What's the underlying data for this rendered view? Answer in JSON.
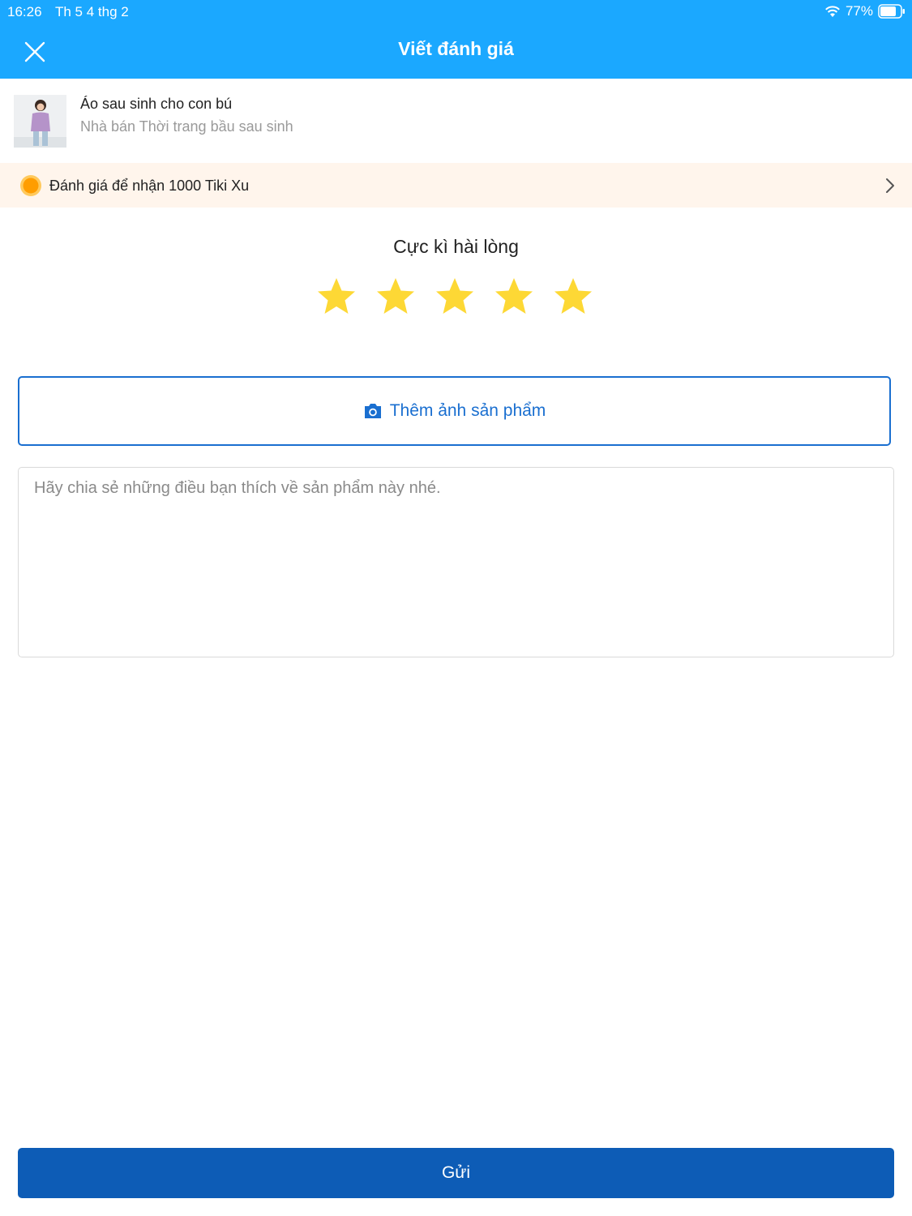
{
  "status_bar": {
    "time": "16:26",
    "date": "Th 5 4 thg 2",
    "battery": "77%"
  },
  "header": {
    "title": "Viết đánh giá"
  },
  "product": {
    "name": "Áo sau sinh cho con bú",
    "seller": "Nhà bán Thời trang bầu sau sinh"
  },
  "promo": {
    "text": "Đánh giá để nhận 1000 Tiki Xu"
  },
  "rating": {
    "label": "Cực kì hài lòng",
    "value": 5,
    "max": 5
  },
  "add_photo": {
    "label": "Thêm ảnh sản phẩm"
  },
  "review": {
    "placeholder": "Hãy chia sẻ những điều bạn thích về sản phẩm này nhé."
  },
  "submit": {
    "label": "Gửi"
  },
  "colors": {
    "header": "#1ba8ff",
    "primary": "#0d5cb6",
    "star": "#fdd835",
    "promo_bg": "#fff5ec"
  }
}
